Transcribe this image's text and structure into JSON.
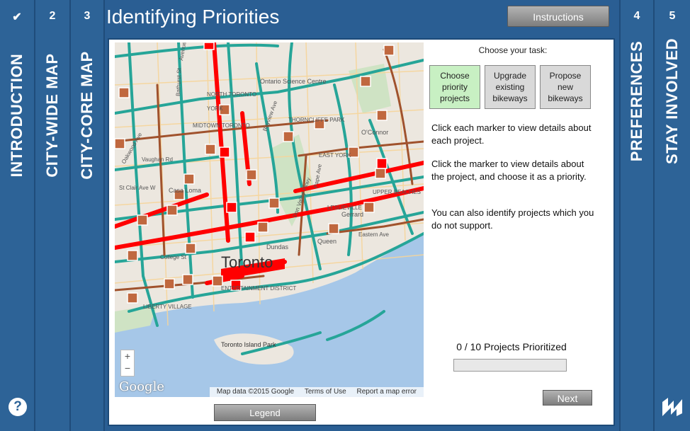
{
  "page": {
    "title": "Identifying Priorities"
  },
  "left_tabs": [
    {
      "num": "✔",
      "label": "INTRODUCTION"
    },
    {
      "num": "2",
      "label": "CITY-WIDE MAP"
    },
    {
      "num": "3",
      "label": "CITY-CORE MAP"
    }
  ],
  "right_tabs": [
    {
      "num": "4",
      "label": "PREFERENCES"
    },
    {
      "num": "5",
      "label": "STAY INVOLVED"
    }
  ],
  "help": {
    "symbol": "?"
  },
  "header": {
    "instructions_label": "Instructions"
  },
  "map": {
    "labels": [
      "Ontario Science Centre",
      "NORTH TORONTO",
      "THORNCLIFFE PARK",
      "YORK",
      "MIDTOWN TORONTO",
      "Casa Loma",
      "EAST YORK",
      "O'Connor",
      "UPPER BEACHES",
      "LESLIEVILLE",
      "Gerrard",
      "Queen",
      "Eastern Ave",
      "Dundas",
      "College St",
      "Toronto",
      "ENTERTAINMENT DISTRICT",
      "LIBERTY VILLAGE",
      "Toronto Island Park",
      "Bathurst St",
      "Avenue Rd",
      "Bayview Ave",
      "Pape Ave",
      "St Clair Ave W",
      "Oakwood Ave",
      "Vaughan Rd",
      "Don Valley Pkwy"
    ],
    "zoom_in": "+",
    "zoom_out": "−",
    "google": "Google",
    "attribution": [
      "Map data ©2015 Google",
      "Terms of Use",
      "Report a map error"
    ]
  },
  "legend_label": "Legend",
  "panel": {
    "choose_label": "Choose your task:",
    "tasks": [
      {
        "label": "Choose priority projects",
        "active": true
      },
      {
        "label": "Upgrade existing bikeways",
        "active": false
      },
      {
        "label": "Propose new bikeways",
        "active": false
      }
    ],
    "para1": "Click each marker to view details about each project.",
    "para2": "Click the marker to view details about the project, and choose it as a priority.",
    "para3": "You can also identify projects which you do not support.",
    "progress": {
      "label": "0 / 10 Projects Prioritized",
      "value": 0,
      "total": 10
    },
    "next_label": "Next"
  },
  "colors": {
    "accent": "#2d6397",
    "route_teal": "#26a598",
    "route_brown": "#a0522d",
    "priority_red": "#ff0000",
    "water": "#a6c7e8"
  }
}
